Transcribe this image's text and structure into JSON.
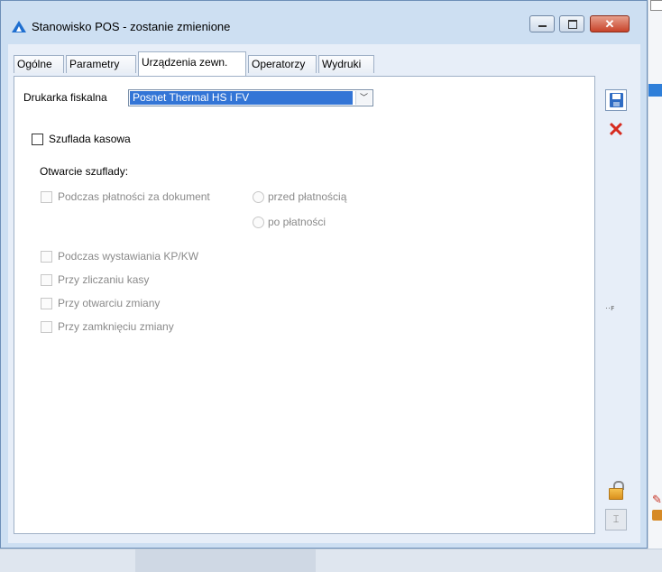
{
  "window": {
    "title": "Stanowisko POS - zostanie zmienione",
    "close_glyph": "✕"
  },
  "tabs": [
    {
      "label": "Ogólne",
      "active": false
    },
    {
      "label": "Parametry",
      "active": false
    },
    {
      "label": "Urządzenia zewn.",
      "active": true
    },
    {
      "label": "Operatorzy",
      "active": false
    },
    {
      "label": "Wydruki",
      "active": false
    }
  ],
  "form": {
    "printer_label": "Drukarka fiskalna",
    "printer_value": "Posnet Thermal HS i FV",
    "cash_drawer_label": "Szuflada kasowa",
    "cash_drawer_checked": false,
    "opening_section_label": "Otwarcie szuflady:",
    "during_payment_label": "Podczas płatności za dokument",
    "before_payment_label": "przed płatnością",
    "after_payment_label": "po płatności",
    "kp_kw_label": "Podczas wystawiania KP/KW",
    "cash_count_label": "Przy zliczaniu kasy",
    "shift_open_label": "Przy otwarciu zmiany",
    "shift_close_label": "Przy zamknięciu zmiany"
  },
  "colors": {
    "accent": "#3375d6",
    "cancel": "#d62a1e"
  }
}
